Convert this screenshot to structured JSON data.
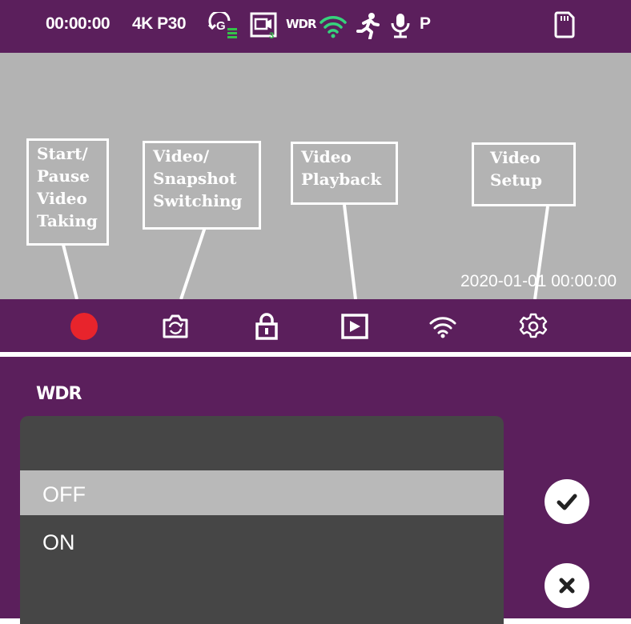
{
  "status_bar": {
    "timer": "00:00:00",
    "resolution": "4K P30",
    "icons": [
      "g-sensor-icon",
      "loop-recording-icon",
      "wdr-icon",
      "wifi-icon",
      "motion-detection-icon",
      "microphone-icon",
      "parking-mode-icon",
      "sd-card-icon"
    ],
    "wdr_label": "WDR",
    "parking_label": "P",
    "loop_badge": "3"
  },
  "viewfinder": {
    "datetime": "2020-01-01  00:00:00"
  },
  "callouts": {
    "record": "Start/\nPause\nVideo\nTaking",
    "mode": "Video/\nSnapshot\nSwitching",
    "playback": "Video\nPlayback",
    "setup": "Video\nSetup"
  },
  "toolbar": {
    "buttons": [
      "record-icon",
      "camera-switch-icon",
      "lock-icon",
      "playback-icon",
      "wifi-icon",
      "settings-icon"
    ]
  },
  "wdr_menu": {
    "title": "WDR",
    "options": [
      {
        "label": "OFF",
        "selected": true
      },
      {
        "label": "ON",
        "selected": false
      }
    ],
    "confirm_icon": "checkmark-icon",
    "cancel_icon": "close-icon"
  },
  "colors": {
    "purple": "#5b1f5c",
    "viewfinder_gray": "#b3b3b3",
    "record_red": "#e8242c",
    "loop_green": "#35c24a",
    "wifi_green": "#36d37c",
    "panel_gray": "#464646",
    "selected_gray": "#b9b9b9"
  }
}
